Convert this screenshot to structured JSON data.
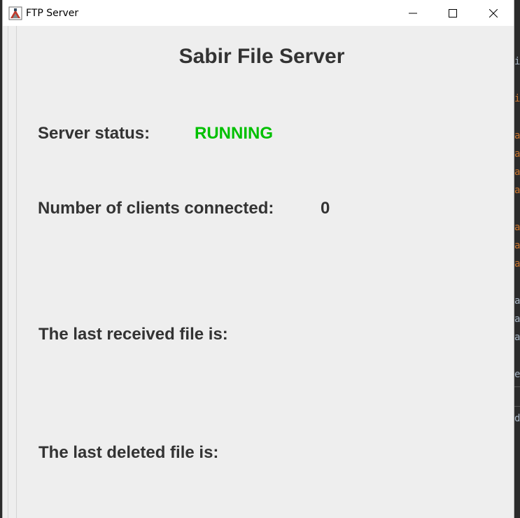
{
  "window": {
    "title": "FTP Server"
  },
  "main": {
    "heading": "Sabir File Server",
    "server_status_label": "Server status:",
    "server_status_value": "RUNNING",
    "clients_label": "Number of clients connected:",
    "clients_value": "0",
    "last_received_label": "The last received file is:",
    "last_deleted_label": "The last deleted file is:"
  },
  "colors": {
    "status_running": "#00c000",
    "text": "#333333",
    "window_bg": "#eeeeee"
  }
}
